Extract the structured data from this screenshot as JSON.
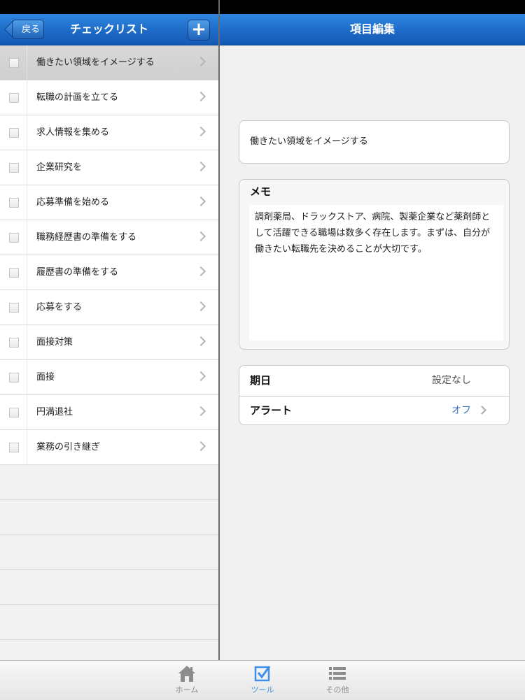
{
  "left": {
    "title": "チェックリスト",
    "back_label": "戻る",
    "add_label": "+",
    "items": [
      {
        "label": "働きたい領域をイメージする",
        "selected": true
      },
      {
        "label": "転職の計画を立てる"
      },
      {
        "label": "求人情報を集める"
      },
      {
        "label": "企業研究を"
      },
      {
        "label": "応募準備を始める"
      },
      {
        "label": "職務経歴書の準備をする"
      },
      {
        "label": "履歴書の準備をする"
      },
      {
        "label": "応募をする"
      },
      {
        "label": "面接対策"
      },
      {
        "label": "面接"
      },
      {
        "label": "円満退社"
      },
      {
        "label": "業務の引き継ぎ"
      }
    ]
  },
  "right": {
    "title": "項目編集",
    "item_title": "働きたい領域をイメージする",
    "memo_label": "メモ",
    "memo_text": "調剤薬局、ドラックストア、病院、製薬企業など薬剤師として活躍できる職場は数多く存在します。まずは、自分が働きたい転職先を決めることが大切です。",
    "due_label": "期日",
    "due_value": "設定なし",
    "alert_label": "アラート",
    "alert_value": "オフ"
  },
  "tabbar": {
    "tabs": [
      {
        "label": "ホーム",
        "icon": "home-icon",
        "active": false
      },
      {
        "label": "ツール",
        "icon": "checkbox-icon",
        "active": true
      },
      {
        "label": "その他",
        "icon": "list-icon",
        "active": false
      }
    ]
  },
  "colors": {
    "nav_blue": "#1f6dca",
    "link_blue": "#3e74c3",
    "tab_active": "#3f8ee7"
  }
}
